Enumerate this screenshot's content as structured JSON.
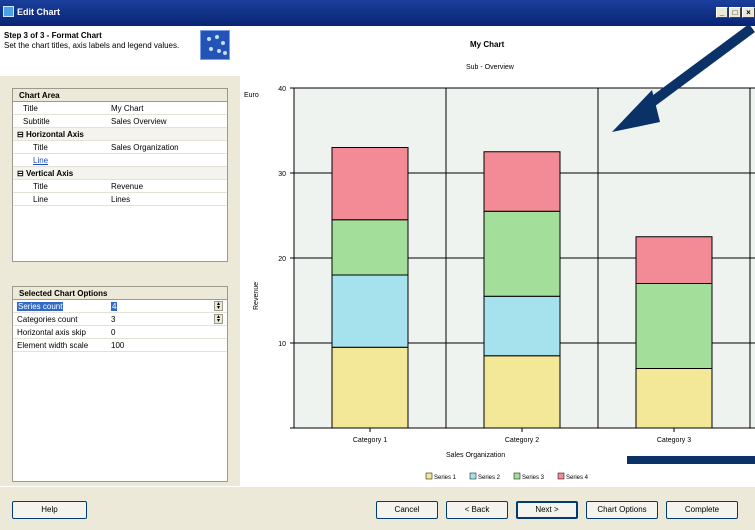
{
  "window": {
    "title": "Edit Chart"
  },
  "header": {
    "step_title": "Step 3 of 3 - Format Chart",
    "step_description": "Set the chart titles, axis labels and legend values."
  },
  "chart_area_panel": {
    "title": "Chart Area",
    "rows": [
      {
        "key": "Title",
        "value": "My Chart"
      },
      {
        "key": "Subtitle",
        "value": "Sales Overview"
      }
    ],
    "horizontal_axis": {
      "label": "Horizontal Axis",
      "rows": [
        {
          "key": "Title",
          "value": "Sales Organization"
        },
        {
          "key": "Line",
          "value": ""
        }
      ]
    },
    "vertical_axis": {
      "label": "Vertical Axis",
      "rows": [
        {
          "key": "Title",
          "value": "Revenue"
        },
        {
          "key": "Line",
          "value": "Lines"
        }
      ]
    }
  },
  "selected_chart_panel": {
    "title": "Selected Chart Options",
    "rows": [
      {
        "key": "Series count",
        "value": "4"
      },
      {
        "key": "Categories count",
        "value": "3"
      },
      {
        "key": "Horizontal axis skip",
        "value": "0"
      },
      {
        "key": "Element width scale",
        "value": "100"
      }
    ]
  },
  "chart": {
    "title": "My Chart",
    "subtitle": "Sub - Overview",
    "y_axis_top_label": "Euro",
    "y_axis_label": "Revenue",
    "x_axis_label": "Sales Organization",
    "legend": [
      "Series 1",
      "Series 2",
      "Series 3",
      "Series 4"
    ]
  },
  "chart_data": {
    "type": "bar",
    "stacked": true,
    "categories": [
      "Category 1",
      "Category 2",
      "Category 3"
    ],
    "series": [
      {
        "name": "Series 1",
        "values": [
          9.5,
          8.5,
          7.0
        ],
        "color": "#f3e898"
      },
      {
        "name": "Series 2",
        "values": [
          8.5,
          7.0,
          0.0
        ],
        "color": "#a6e1ee"
      },
      {
        "name": "Series 3",
        "values": [
          6.5,
          10.0,
          10.0
        ],
        "color": "#a3df9b"
      },
      {
        "name": "Series 4",
        "values": [
          8.5,
          7.0,
          5.5
        ],
        "color": "#f28b95"
      }
    ],
    "ylim": [
      0,
      40
    ],
    "yticks": [
      0,
      10,
      20,
      30,
      40
    ],
    "ytick_labels": [
      "",
      "10",
      "20",
      "30",
      "40"
    ],
    "grid": true
  },
  "footer": {
    "help": "Help",
    "cancel": "Cancel",
    "back": "< Back",
    "next": "Next >",
    "chart_options": "Chart Options",
    "complete": "Complete"
  },
  "colors": {
    "titlebar": "#0a2474",
    "plot_bg": "#eef3ef",
    "arrow": "#0b3266"
  }
}
